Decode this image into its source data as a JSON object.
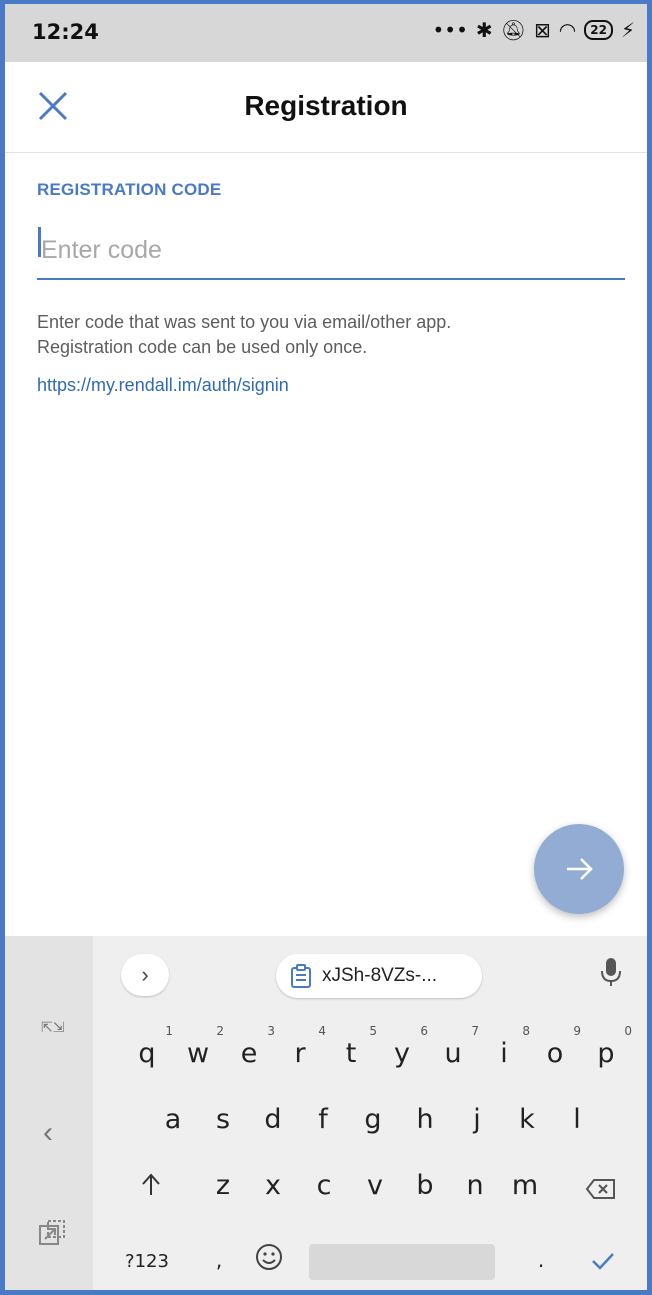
{
  "status": {
    "time": "12:24",
    "battery": "22"
  },
  "appbar": {
    "title": "Registration"
  },
  "form": {
    "label": "REGISTRATION CODE",
    "placeholder": "Enter code",
    "help_line1": "Enter code that was sent to you via email/other app.",
    "help_line2": "Registration code can be used only once.",
    "link": "https://my.rendall.im/auth/signin"
  },
  "keyboard": {
    "clipboard_text": "xJSh-8VZs-...",
    "row1": [
      "q",
      "w",
      "e",
      "r",
      "t",
      "y",
      "u",
      "i",
      "o",
      "p"
    ],
    "row1_numbers": [
      "1",
      "2",
      "3",
      "4",
      "5",
      "6",
      "7",
      "8",
      "9",
      "0"
    ],
    "row2": [
      "a",
      "s",
      "d",
      "f",
      "g",
      "h",
      "j",
      "k",
      "l"
    ],
    "row3": [
      "z",
      "x",
      "c",
      "v",
      "b",
      "n",
      "m"
    ],
    "symbols_key": "?123",
    "comma_key": ",",
    "period_key": "."
  },
  "colors": {
    "accent": "#4a79c5",
    "fab": "#93acd3",
    "link": "#2f6bb4"
  }
}
